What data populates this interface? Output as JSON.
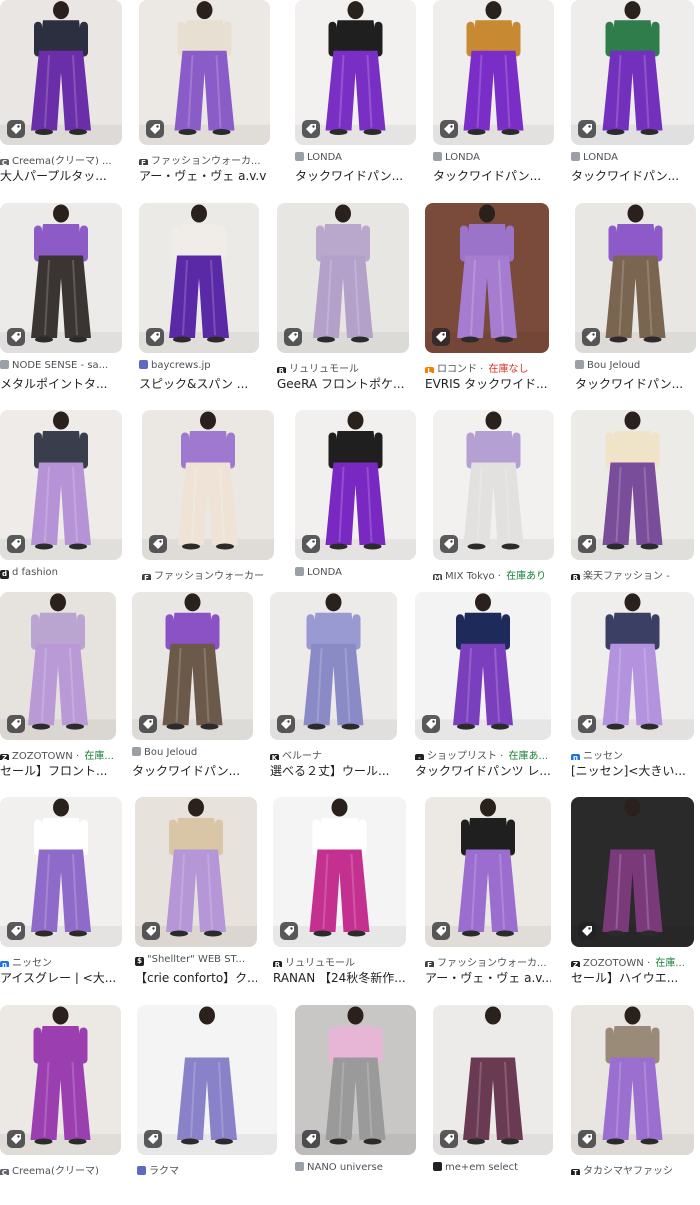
{
  "rows": [
    {
      "items": [
        {
          "source": "Creema(クリーマ) ...",
          "title": "大人パープルタッ...",
          "favicon_color": "#5f6368",
          "favicon_char": "C",
          "bg": "#e9e6e3",
          "pants": "#6a2ea8",
          "top": "#2c2f3f"
        },
        {
          "source": "ファッションウォーカ...",
          "title": "アー・ヴェ・ヴェ a.v.v ...",
          "favicon_color": "#3c4043",
          "favicon_char": "F",
          "bg": "#ece9e4",
          "pants": "#8a5cc7",
          "top": "#e6dfd2"
        },
        {
          "source": "LONDA",
          "title": "タックワイドパン...",
          "favicon_color": "#9aa0a6",
          "favicon_char": "",
          "bg": "#f2f1f0",
          "pants": "#7a2fc4",
          "top": "#1f1f1f"
        },
        {
          "source": "LONDA",
          "title": "タックワイドパン...",
          "favicon_color": "#9aa0a6",
          "favicon_char": "",
          "bg": "#efeeed",
          "pants": "#7b2dc7",
          "top": "#c78a33"
        },
        {
          "source": "LONDA",
          "title": "タックワイドパン...",
          "favicon_color": "#9aa0a6",
          "favicon_char": "",
          "bg": "#eeedec",
          "pants": "#7330bd",
          "top": "#2e7d4a"
        }
      ]
    },
    {
      "items": [
        {
          "source": "NODE SENSE - sa...",
          "title": "メタルポイントタ...",
          "favicon_color": "#9aa0a6",
          "favicon_char": "",
          "bg": "#ecebe9",
          "pants": "#3a3533",
          "top": "#8c5bc6"
        },
        {
          "source": "baycrews.jp",
          "title": "スピック&スパン ...",
          "favicon_color": "#5c6bc0",
          "favicon_char": "",
          "bg": "#eceae7",
          "pants": "#5a2aa6",
          "top": "#f0ede8"
        },
        {
          "source": "リュリュモール",
          "title": "GeeRA フロントポケ...",
          "favicon_color": "#202124",
          "favicon_char": "R",
          "bg": "#e8e6e3",
          "pants": "#b3a1c9",
          "top": "#b9a7cc"
        },
        {
          "source": "ロコンド",
          "title": "EVRIS タックワイド...",
          "favicon_color": "#f57c00",
          "favicon_char": "L",
          "stock": "在庫なし",
          "stock_color": "#d93025",
          "bg": "#7a4a3a",
          "pants": "#a57cd0",
          "top": "#9b74c9"
        },
        {
          "source": "Bou Jeloud",
          "title": "タックワイドパン...",
          "favicon_color": "#9aa0a6",
          "favicon_char": "",
          "bg": "#e9e7e4",
          "pants": "#7a6550",
          "top": "#8e5ac9"
        }
      ]
    },
    {
      "items": [
        {
          "source": "d fashion",
          "title": "",
          "favicon_color": "#202124",
          "favicon_char": "d",
          "bg": "#eeebe8",
          "pants": "#b693d6",
          "top": "#3a3d4c"
        },
        {
          "source": "ファッションウォーカー",
          "title": "",
          "favicon_color": "#3c4043",
          "favicon_char": "F",
          "bg": "#ebe8e3",
          "pants": "#eee3d6",
          "top": "#9e79cf"
        },
        {
          "source": "LONDA",
          "title": "",
          "favicon_color": "#9aa0a6",
          "favicon_char": "",
          "bg": "#f1f0ef",
          "pants": "#7a28c2",
          "top": "#1f1f1f"
        },
        {
          "source": "MIX Tokyo",
          "title": "",
          "favicon_color": "#3c4043",
          "favicon_char": "M",
          "stock": "在庫あり",
          "stock_color": "#188038",
          "bg": "#f2f1f0",
          "pants": "#e3e1df",
          "top": "#b4a0d3"
        },
        {
          "source": "楽天ファッション -",
          "title": "",
          "favicon_color": "#202124",
          "favicon_char": "R",
          "bg": "#ecebe8",
          "pants": "#7a4d9a",
          "top": "#efe3c8"
        }
      ]
    },
    {
      "items": [
        {
          "source": "ZOZOTOWN",
          "title": "セール】フロント...",
          "favicon_color": "#202124",
          "favicon_char": "Z",
          "stock": "在庫...",
          "stock_color": "#188038",
          "bg": "#e6e3df",
          "pants": "#b99ad6",
          "top": "#b9a5cf"
        },
        {
          "source": "Bou Jeloud",
          "title": "タックワイドパン...",
          "favicon_color": "#9aa0a6",
          "favicon_char": "",
          "bg": "#e9e7e4",
          "pants": "#6b5a4a",
          "top": "#8a52c5"
        },
        {
          "source": "ベルーナ",
          "title": "選べる２丈】ウール...",
          "favicon_color": "#202124",
          "favicon_char": "K",
          "bg": "#ecebea",
          "pants": "#8a8ac7",
          "top": "#9a9ad2"
        },
        {
          "source": "ショップリスト",
          "title": "タックワイドパンツ レ...",
          "favicon_color": "#202124",
          "favicon_char": "-",
          "stock": "在庫あ...",
          "stock_color": "#188038",
          "bg": "#f3f3f3",
          "pants": "#7b3fbe",
          "top": "#1d2a5a"
        },
        {
          "source": "ニッセン",
          "title": "[ニッセン]<大きい...",
          "favicon_color": "#1a73e8",
          "favicon_char": "n",
          "bg": "#efeeed",
          "pants": "#b393de",
          "top": "#3b3f63"
        }
      ]
    },
    {
      "items": [
        {
          "source": "ニッセン",
          "title": "アイスグレー | <大...",
          "favicon_color": "#1a73e8",
          "favicon_char": "n",
          "bg": "#f1f0ee",
          "pants": "#8f6bc9",
          "top": "#ffffff"
        },
        {
          "source": "\"Shellter\" WEB ST...",
          "title": "【crie conforto】ク...",
          "favicon_color": "#202124",
          "favicon_char": "$",
          "bg": "#e7e3dc",
          "pants": "#b596d6",
          "top": "#d9c6a6"
        },
        {
          "source": "リュリュモール",
          "title": "RANAN 【24秋冬新作...",
          "favicon_color": "#202124",
          "favicon_char": "R",
          "bg": "#f4f4f4",
          "pants": "#c4308f",
          "top": "#ffffff"
        },
        {
          "source": "ファッションウォーカ...",
          "title": "アー・ヴェ・ヴェ a.v...",
          "favicon_color": "#3c4043",
          "favicon_char": "F",
          "bg": "#ece9e4",
          "pants": "#9a6dcf",
          "top": "#1f1f1f"
        },
        {
          "source": "ZOZOTOWN",
          "title": "セール】ハイウエ...",
          "favicon_color": "#202124",
          "favicon_char": "Z",
          "stock": "在庫...",
          "stock_color": "#188038",
          "bg": "#2a2a2a",
          "pants": "#7a3a7a",
          "top": "#2a2a2a"
        }
      ]
    },
    {
      "items": [
        {
          "source": "Creema(クリーマ)",
          "title": "",
          "favicon_color": "#5f6368",
          "favicon_char": "C",
          "bg": "#ece8e4",
          "pants": "#9b3fb0",
          "top": "#9b3fb0"
        },
        {
          "source": "ラクマ",
          "title": "",
          "favicon_color": "#5c6bc0",
          "favicon_char": "",
          "bg": "#f4f4f4",
          "pants": "#8a82c8",
          "top": "#f4f4f4"
        },
        {
          "source": "NANO universe",
          "title": "",
          "favicon_color": "#9aa0a6",
          "favicon_char": "",
          "bg": "#c9c7c5",
          "pants": "#9a9a9a",
          "top": "#e7b6d6"
        },
        {
          "source": "me+em select",
          "title": "",
          "favicon_color": "#202124",
          "favicon_char": "",
          "bg": "#ecebe9",
          "pants": "#6a3a52",
          "top": "#ecebe9"
        },
        {
          "source": "タカシマヤファッシ",
          "title": "",
          "favicon_color": "#202124",
          "favicon_char": "T",
          "bg": "#e9e6e2",
          "pants": "#9a6fcf",
          "top": "#9a8a78"
        }
      ]
    }
  ]
}
